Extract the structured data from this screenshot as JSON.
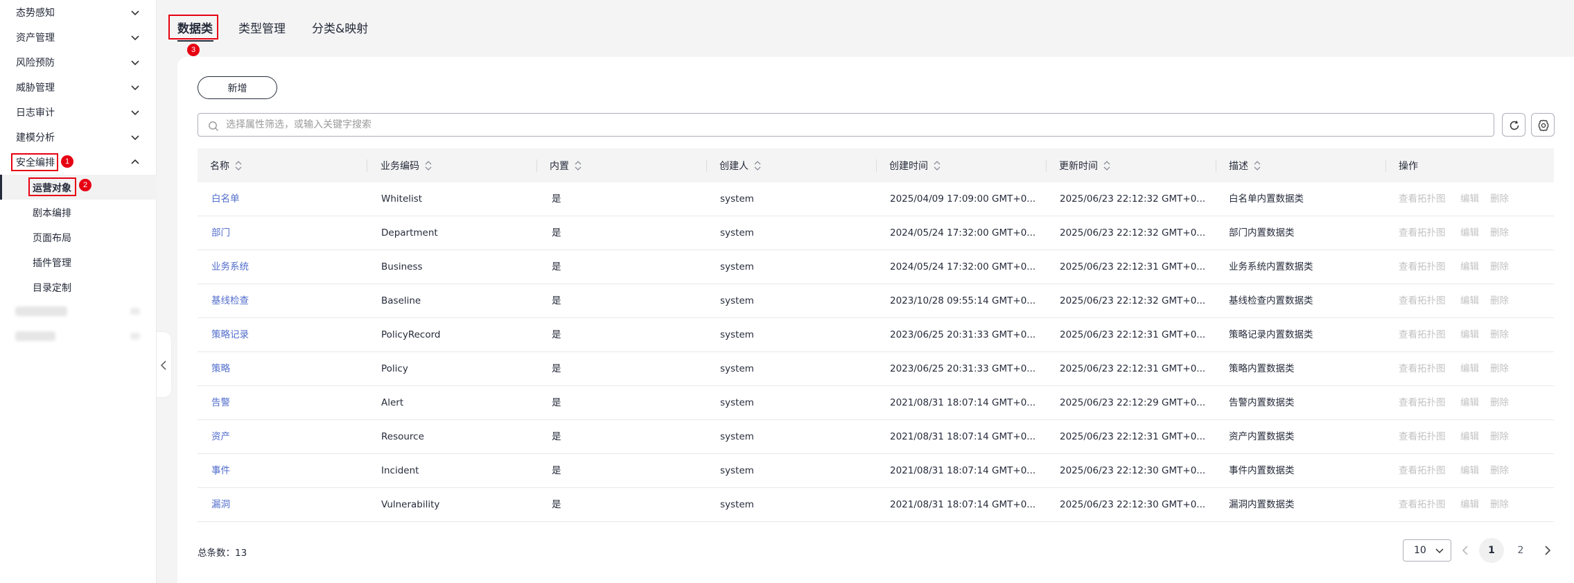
{
  "sidebar": {
    "groups": [
      {
        "label": "态势感知",
        "expanded": false
      },
      {
        "label": "资产管理",
        "expanded": false
      },
      {
        "label": "风险预防",
        "expanded": false
      },
      {
        "label": "威胁管理",
        "expanded": false
      },
      {
        "label": "日志审计",
        "expanded": false
      },
      {
        "label": "建模分析",
        "expanded": false
      },
      {
        "label": "安全编排",
        "expanded": true
      }
    ],
    "sub_items": [
      {
        "label": "运营对象",
        "active": true
      },
      {
        "label": "剧本编排"
      },
      {
        "label": "页面布局"
      },
      {
        "label": "插件管理"
      },
      {
        "label": "目录定制"
      }
    ]
  },
  "annotations": {
    "step1": "1",
    "step2": "2",
    "step3": "3"
  },
  "tabs": [
    {
      "label": "数据类",
      "active": true
    },
    {
      "label": "类型管理"
    },
    {
      "label": "分类&映射"
    }
  ],
  "toolbar": {
    "new_label": "新增"
  },
  "search": {
    "placeholder": "选择属性筛选，或输入关键字搜索"
  },
  "table": {
    "columns": [
      "名称",
      "业务编码",
      "内置",
      "创建人",
      "创建时间",
      "更新时间",
      "描述",
      "操作"
    ],
    "actions": [
      "查看拓扑图",
      "编辑",
      "删除"
    ],
    "rows": [
      {
        "name": "白名单",
        "code": "Whitelist",
        "builtin": "是",
        "creator": "system",
        "created": "2025/04/09 17:09:00 GMT+0...",
        "updated": "2025/06/23 22:12:32 GMT+0...",
        "desc": "白名单内置数据类"
      },
      {
        "name": "部门",
        "code": "Department",
        "builtin": "是",
        "creator": "system",
        "created": "2024/05/24 17:32:00 GMT+0...",
        "updated": "2025/06/23 22:12:32 GMT+0...",
        "desc": "部门内置数据类"
      },
      {
        "name": "业务系统",
        "code": "Business",
        "builtin": "是",
        "creator": "system",
        "created": "2024/05/24 17:32:00 GMT+0...",
        "updated": "2025/06/23 22:12:31 GMT+0...",
        "desc": "业务系统内置数据类"
      },
      {
        "name": "基线检查",
        "code": "Baseline",
        "builtin": "是",
        "creator": "system",
        "created": "2023/10/28 09:55:14 GMT+0...",
        "updated": "2025/06/23 22:12:32 GMT+0...",
        "desc": "基线检查内置数据类"
      },
      {
        "name": "策略记录",
        "code": "PolicyRecord",
        "builtin": "是",
        "creator": "system",
        "created": "2023/06/25 20:31:33 GMT+0...",
        "updated": "2025/06/23 22:12:31 GMT+0...",
        "desc": "策略记录内置数据类"
      },
      {
        "name": "策略",
        "code": "Policy",
        "builtin": "是",
        "creator": "system",
        "created": "2023/06/25 20:31:33 GMT+0...",
        "updated": "2025/06/23 22:12:31 GMT+0...",
        "desc": "策略内置数据类"
      },
      {
        "name": "告警",
        "code": "Alert",
        "builtin": "是",
        "creator": "system",
        "created": "2021/08/31 18:07:14 GMT+0...",
        "updated": "2025/06/23 22:12:29 GMT+0...",
        "desc": "告警内置数据类"
      },
      {
        "name": "资产",
        "code": "Resource",
        "builtin": "是",
        "creator": "system",
        "created": "2021/08/31 18:07:14 GMT+0...",
        "updated": "2025/06/23 22:12:31 GMT+0...",
        "desc": "资产内置数据类"
      },
      {
        "name": "事件",
        "code": "Incident",
        "builtin": "是",
        "creator": "system",
        "created": "2021/08/31 18:07:14 GMT+0...",
        "updated": "2025/06/23 22:12:30 GMT+0...",
        "desc": "事件内置数据类"
      },
      {
        "name": "漏洞",
        "code": "Vulnerability",
        "builtin": "是",
        "creator": "system",
        "created": "2021/08/31 18:07:14 GMT+0...",
        "updated": "2025/06/23 22:12:30 GMT+0...",
        "desc": "漏洞内置数据类"
      }
    ]
  },
  "footer": {
    "total_label": "总条数：",
    "total": "13",
    "page_size": "10",
    "pages": [
      "1",
      "2"
    ],
    "current_page": "1"
  },
  "colors": {
    "link": "#526ecc",
    "highlight": "#e60012",
    "disabled": "#c2c2c2"
  }
}
